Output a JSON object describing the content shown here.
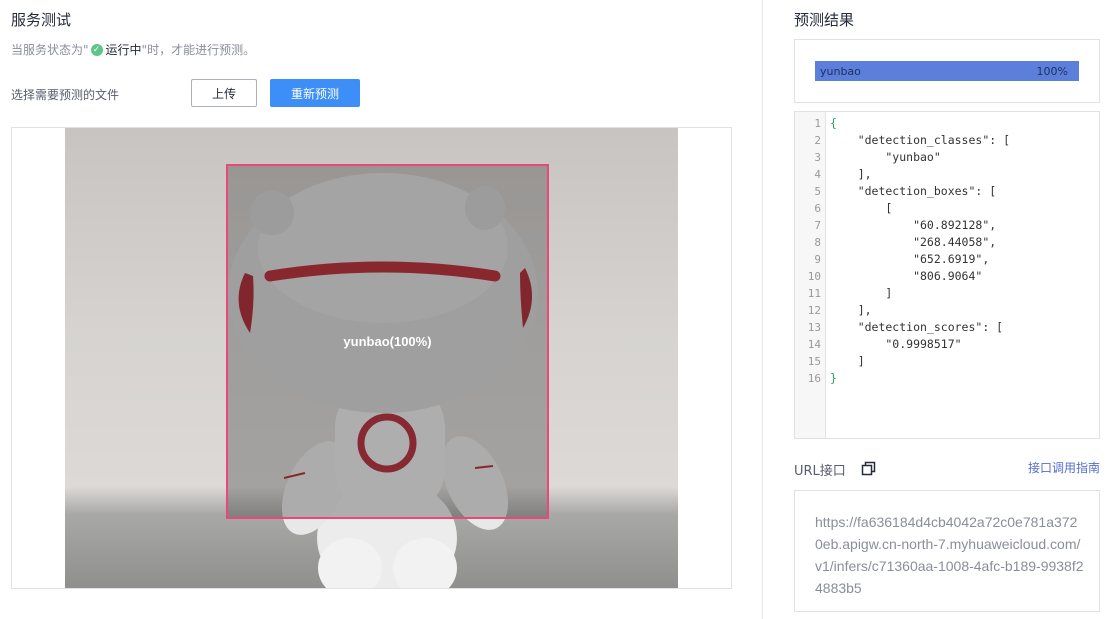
{
  "left": {
    "title": "服务测试",
    "status": {
      "prefix": "当服务状态为\"",
      "running": "运行中",
      "suffix": "\"时，才能进行预测。"
    },
    "file_label": "选择需要预测的文件",
    "upload_button": "上传",
    "repredict_button": "重新预测",
    "detection_label": "yunbao(100%)"
  },
  "right": {
    "title": "预测结果",
    "result": {
      "class": "yunbao",
      "percent": "100%",
      "score_fraction": 1.0
    },
    "code": {
      "line_numbers": [
        "1",
        "2",
        "3",
        "4",
        "5",
        "6",
        "7",
        "8",
        "9",
        "10",
        "11",
        "12",
        "13",
        "14",
        "15",
        "16"
      ],
      "lines": [
        "{",
        "    \"detection_classes\": [",
        "        \"yunbao\"",
        "    ],",
        "    \"detection_boxes\": [",
        "        [",
        "            \"60.892128\",",
        "            \"268.44058\",",
        "            \"652.6919\",",
        "            \"806.9064\"",
        "        ]",
        "    ],",
        "    \"detection_scores\": [",
        "        \"0.9998517\"",
        "    ]",
        "}"
      ]
    },
    "url_label": "URL接口",
    "guide_link": "接口调用指南",
    "url": "https://fa636184d4cb4042a72c0e781a3720eb.apigw.cn-north-7.myhuaweicloud.com/v1/infers/c71360aa-1008-4afc-b189-9938f24883b5"
  },
  "icons": {
    "status": "check-circle-icon",
    "copy": "copy-icon"
  },
  "colors": {
    "primary": "#3e8ef7",
    "success": "#5fc48a",
    "bbox": "#e8487a",
    "result_bar": "#5b7fdb",
    "link": "#526ecc"
  }
}
